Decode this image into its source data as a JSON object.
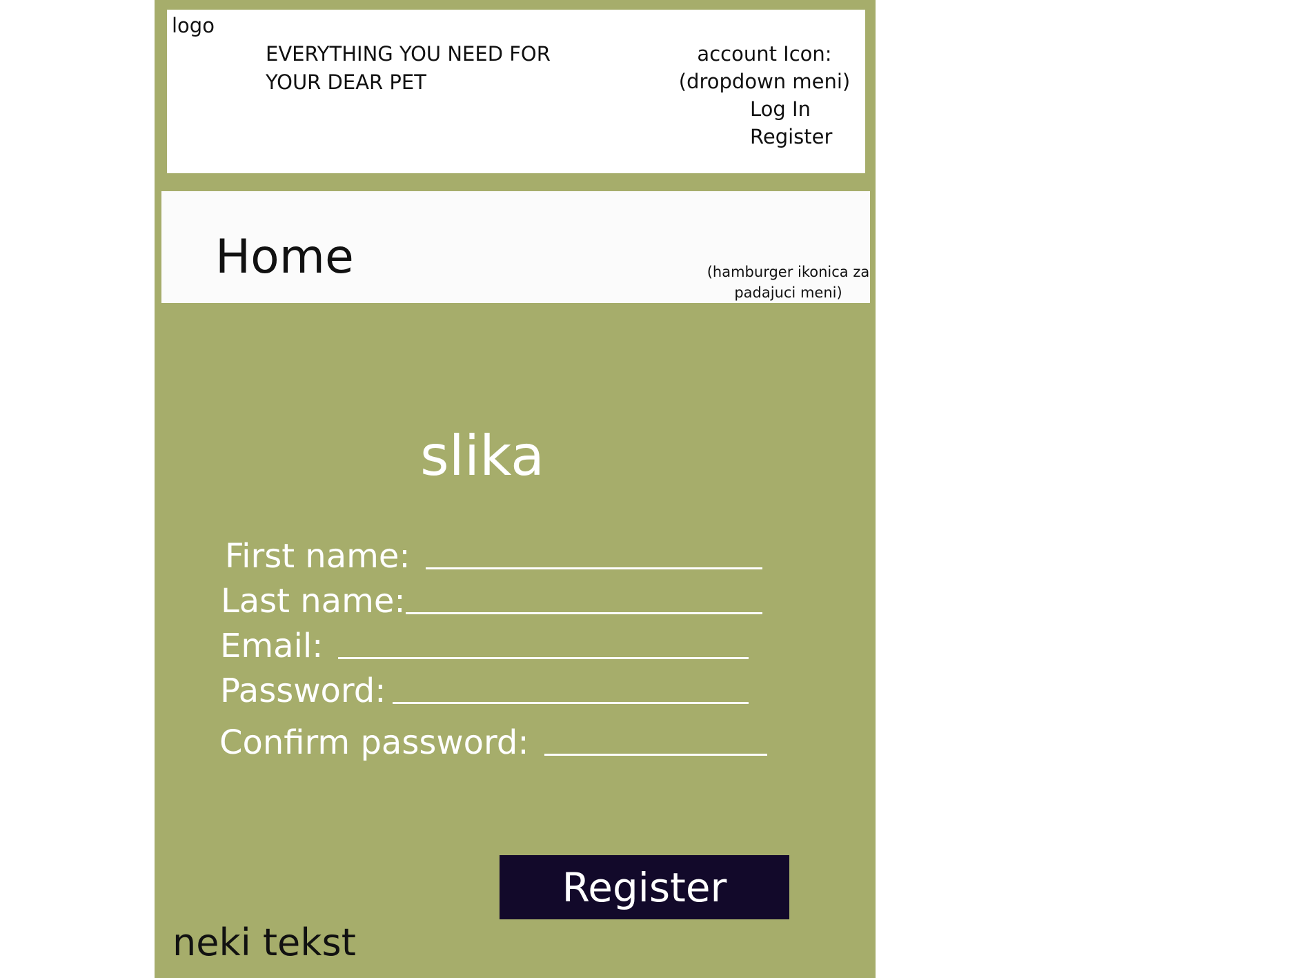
{
  "header": {
    "logo_label": "logo",
    "tagline_line1": "EVERYTHING YOU NEED FOR",
    "tagline_line2": "YOUR DEAR PET",
    "account_line1": "account Icon:",
    "account_line2": "(dropdown meni)",
    "login_label": "Log In",
    "register_label": "Register"
  },
  "nav": {
    "home_label": "Home",
    "hamburger_line1": "(hamburger ikonica za",
    "hamburger_line2": "padajuci meni)"
  },
  "main": {
    "image_placeholder": "slika",
    "form": {
      "first_name_label": "First name:",
      "last_name_label": "Last name:",
      "email_label": "Email:",
      "password_label": "Password:",
      "confirm_password_label": "Confirm password:"
    },
    "register_button_label": "Register"
  },
  "footer": {
    "text": "neki tekst"
  },
  "colors": {
    "panel_background": "#a6ad6b",
    "button_background": "#12092a",
    "header_background": "#ffffff"
  }
}
